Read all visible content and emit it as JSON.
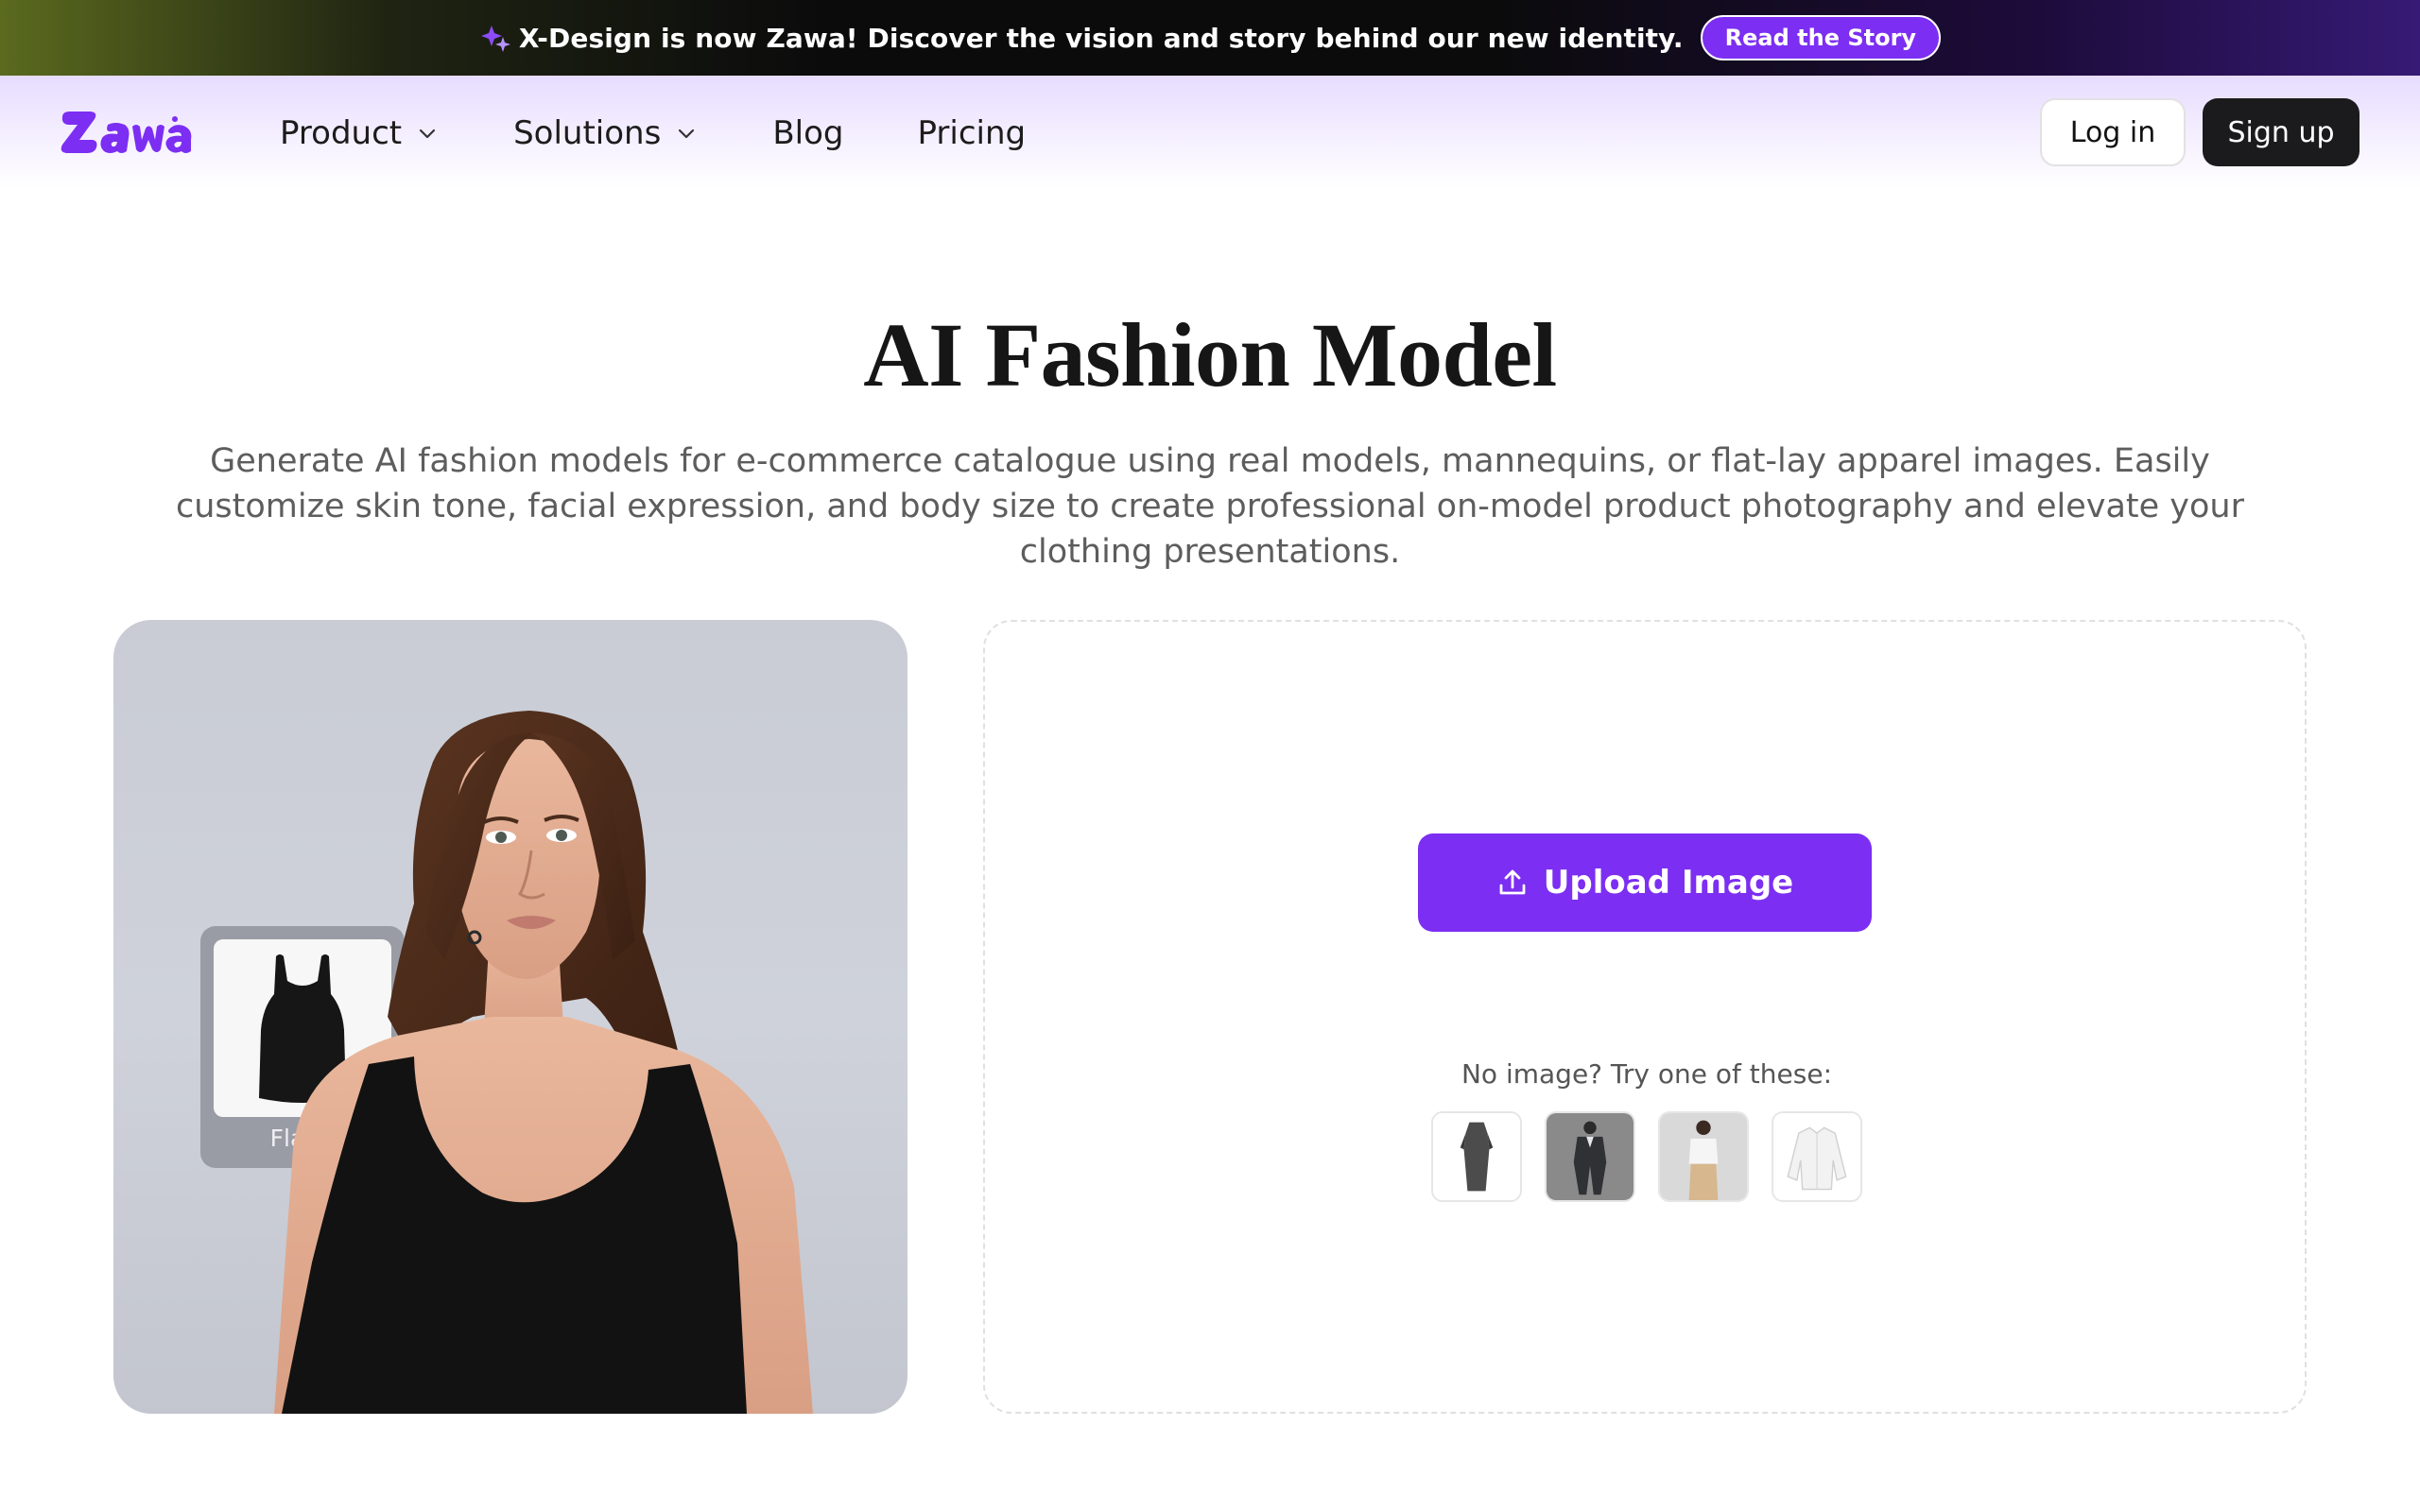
{
  "banner": {
    "text": "X-Design is now Zawa! Discover the vision and story behind our new identity.",
    "button_label": "Read the Story",
    "sparkle_icon": "sparkle-icon"
  },
  "header": {
    "logo_text": "Zawa",
    "nav": [
      {
        "label": "Product",
        "has_dropdown": true
      },
      {
        "label": "Solutions",
        "has_dropdown": true
      },
      {
        "label": "Blog",
        "has_dropdown": false
      },
      {
        "label": "Pricing",
        "has_dropdown": false
      }
    ],
    "login_label": "Log in",
    "signup_label": "Sign up"
  },
  "hero": {
    "title": "AI Fashion Model",
    "subtitle": "Generate AI fashion models for e-commerce catalogue using real models, mannequins, or flat-lay apparel images. Easily customize skin tone, facial expression, and body size to create professional on-model product photography and elevate your clothing presentations."
  },
  "showcase": {
    "flatlay_label": "Flatla"
  },
  "upload": {
    "button_label": "Upload Image",
    "try_label": "No image? Try one of these:",
    "samples": [
      "sample-dress",
      "sample-suit",
      "sample-blouse-model",
      "sample-white-shirt"
    ]
  },
  "colors": {
    "accent": "#7c2ef2",
    "dark_button": "#1b1b1d"
  }
}
